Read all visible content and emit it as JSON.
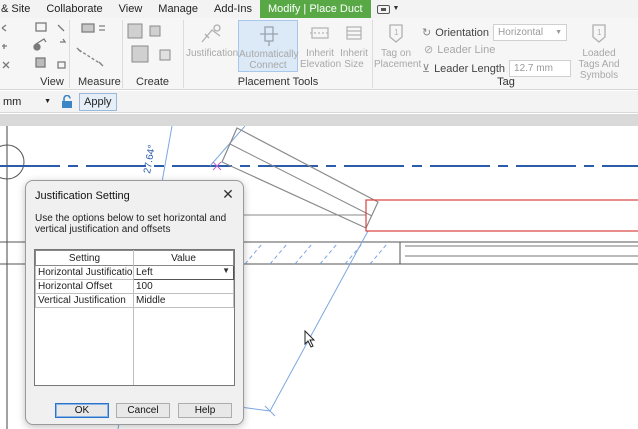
{
  "menu": {
    "tabs": [
      "& Site",
      "Collaborate",
      "View",
      "Manage",
      "Add-Ins",
      "Modify | Place Duct"
    ],
    "active_tab": "Modify | Place Duct",
    "accent_color": "#58a946"
  },
  "ribbon": {
    "panels": {
      "view": "View",
      "measure": "Measure",
      "create": "Create",
      "placement_tools": "Placement Tools",
      "tag": "Tag"
    },
    "placement_tools": {
      "justification": "Justification",
      "auto_connect_line1": "Automatically",
      "auto_connect_line2": "Connect",
      "inherit_elevation_line1": "Inherit",
      "inherit_elevation_line2": "Elevation",
      "inherit_size_line1": "Inherit",
      "inherit_size_line2": "Size"
    },
    "tag": {
      "tag_on_placement_line1": "Tag on",
      "tag_on_placement_line2": "Placement",
      "orientation_label": "Orientation",
      "orientation_value": "Horizontal",
      "leader_line_label": "Leader Line",
      "leader_length_label": "Leader Length",
      "leader_length_value": "12.7 mm",
      "loaded_tags_line1": "Loaded",
      "loaded_tags_line2": "Tags And Symbols"
    }
  },
  "options_bar": {
    "unit_value": "mm",
    "apply_label": "Apply"
  },
  "canvas": {
    "annotation": "27.64°",
    "duct_color": "#d94040",
    "centerline_color": "#2a5caa",
    "guide_color": "#7da7e0"
  },
  "dialog": {
    "title": "Justification Setting",
    "description": "Use the options below to set horizontal and vertical justification and offsets",
    "columns": [
      "Setting",
      "Value"
    ],
    "rows": [
      {
        "setting": "Horizontal Justification",
        "value": "Left"
      },
      {
        "setting": "Horizontal Offset",
        "value": "100"
      },
      {
        "setting": "Vertical Justification",
        "value": "Middle"
      }
    ],
    "buttons": {
      "ok": "OK",
      "cancel": "Cancel",
      "help": "Help"
    }
  }
}
